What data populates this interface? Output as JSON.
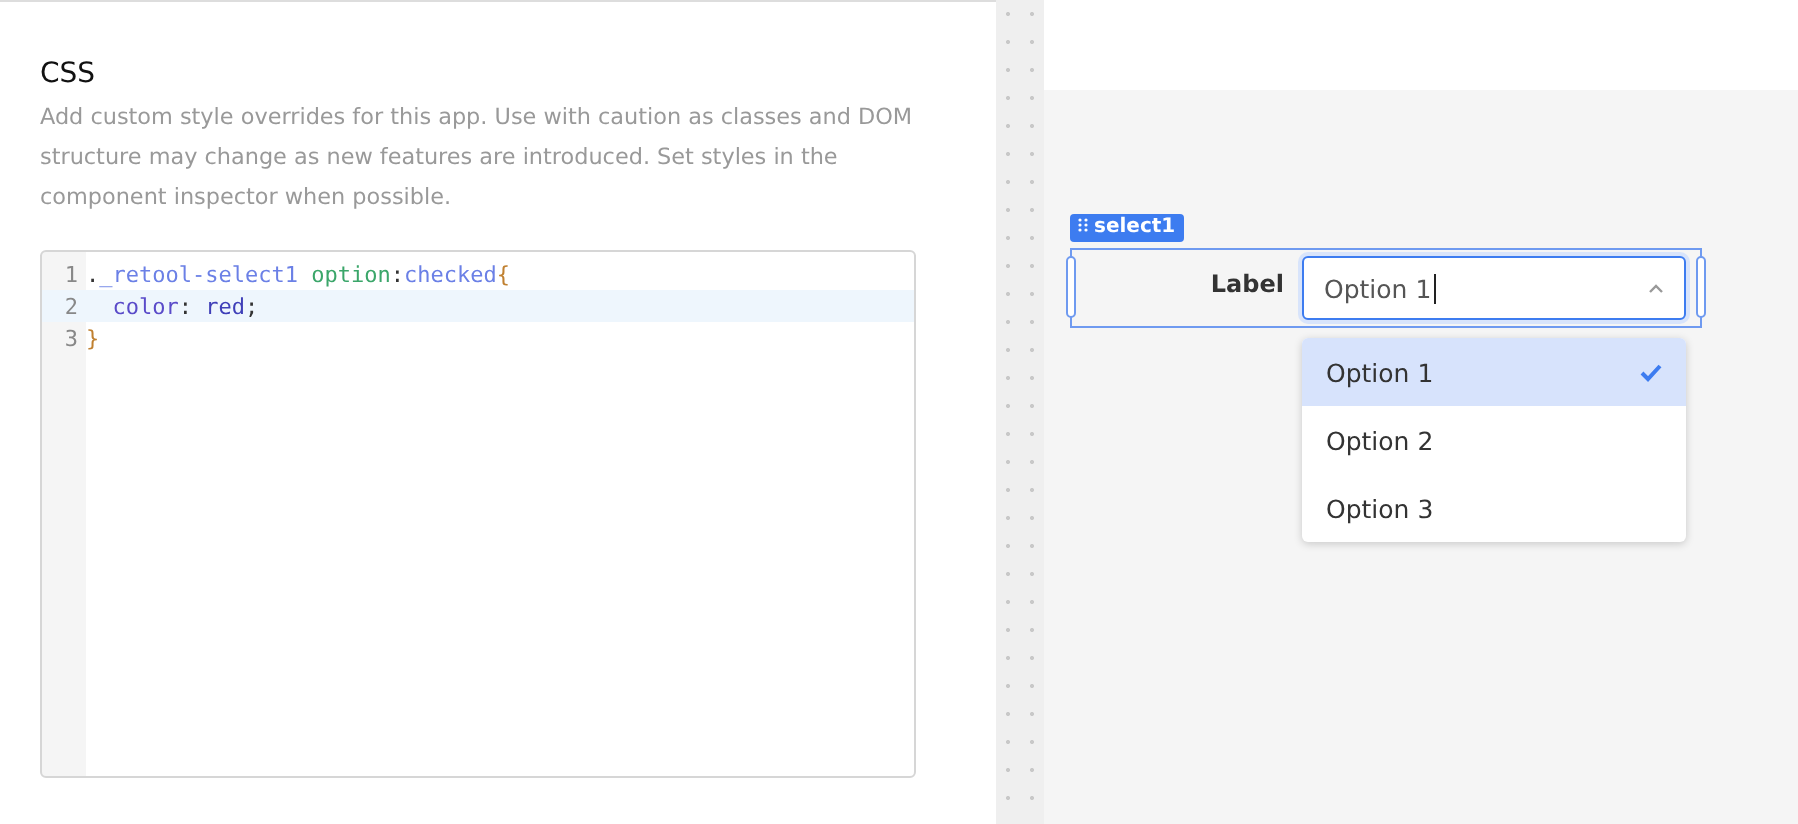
{
  "css_panel": {
    "title": "CSS",
    "description": "Add custom style overrides for this app. Use with caution as classes and DOM structure may change as new features are introduced. Set styles in the component inspector when possible.",
    "code_lines": [
      {
        "number": "1",
        "selected": false,
        "tokens": [
          {
            "kind": "punct",
            "text": "."
          },
          {
            "kind": "selector",
            "text": "_retool-select1"
          },
          {
            "kind": "tag",
            "text": " option"
          },
          {
            "kind": "punct",
            "text": ":"
          },
          {
            "kind": "selector",
            "text": "checked"
          },
          {
            "kind": "bracket",
            "text": "{"
          }
        ]
      },
      {
        "number": "2",
        "selected": true,
        "tokens": [
          {
            "kind": "property",
            "text": "  color"
          },
          {
            "kind": "punct",
            "text": ": "
          },
          {
            "kind": "value",
            "text": "red"
          },
          {
            "kind": "punct",
            "text": ";"
          }
        ]
      },
      {
        "number": "3",
        "selected": false,
        "tokens": [
          {
            "kind": "bracket",
            "text": "}"
          }
        ]
      }
    ]
  },
  "canvas": {
    "component_badge": "select1",
    "select": {
      "label": "Label",
      "value": "Option 1",
      "expanded": true,
      "options": [
        {
          "label": "Option 1",
          "selected": true
        },
        {
          "label": "Option 2",
          "selected": false
        },
        {
          "label": "Option 3",
          "selected": false
        }
      ]
    }
  }
}
